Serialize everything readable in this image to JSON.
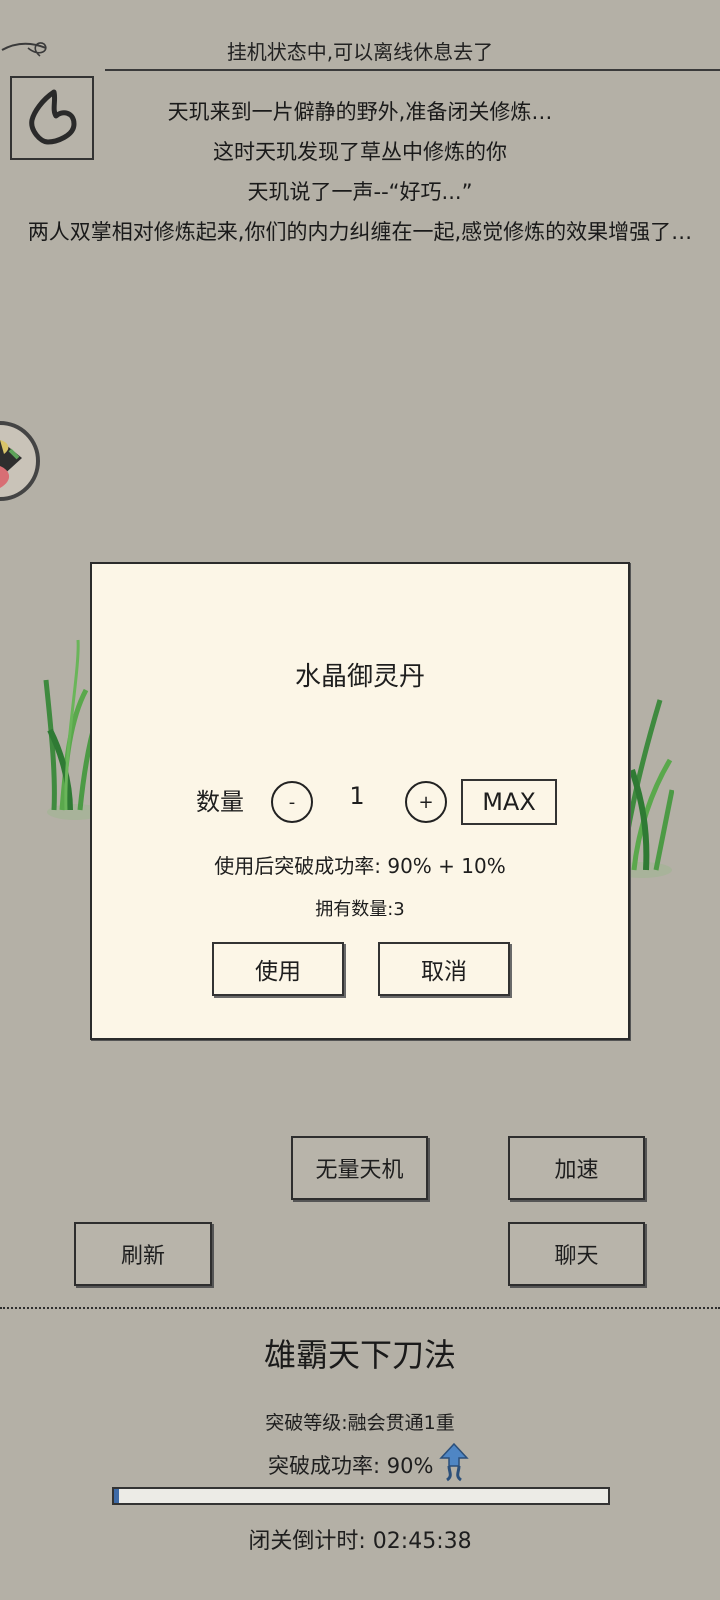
{
  "header": {
    "status_text": "挂机状态中,可以离线休息去了"
  },
  "back_icon": "back-arrow-icon",
  "story": {
    "lines": [
      "天玑来到一片僻静的野外,准备闭关修炼…",
      "这时天玑发现了草丛中修炼的你",
      "天玑说了一声--“好巧...”",
      "两人双掌相对修炼起来,你们的内力纠缠在一起,感觉修炼的效果增强了…"
    ]
  },
  "dialog": {
    "item_name": "水晶御灵丹",
    "quantity_label": "数量",
    "minus_label": "-",
    "quantity_value": "1",
    "plus_label": "+",
    "max_label": "MAX",
    "rate_text": "使用后突破成功率:  90% + 10%",
    "owned_text": "拥有数量:3",
    "use_label": "使用",
    "cancel_label": "取消"
  },
  "actions": {
    "wuliang_label": "无量天机",
    "jiasu_label": "加速",
    "shuaxin_label": "刷新",
    "liaotian_label": "聊天"
  },
  "skill": {
    "name": "雄霸天下刀法",
    "level_text": "突破等级:融会贯通1重",
    "rate_text": "突破成功率: 90%",
    "progress_fraction": 0.01,
    "countdown_text": "闭关倒计时: 02:45:38"
  },
  "colors": {
    "background": "#b4b0a6",
    "dialog_bg": "#fcf6e7",
    "progress_fill": "#3e6aa6",
    "up_arrow": "#4f86c4"
  }
}
